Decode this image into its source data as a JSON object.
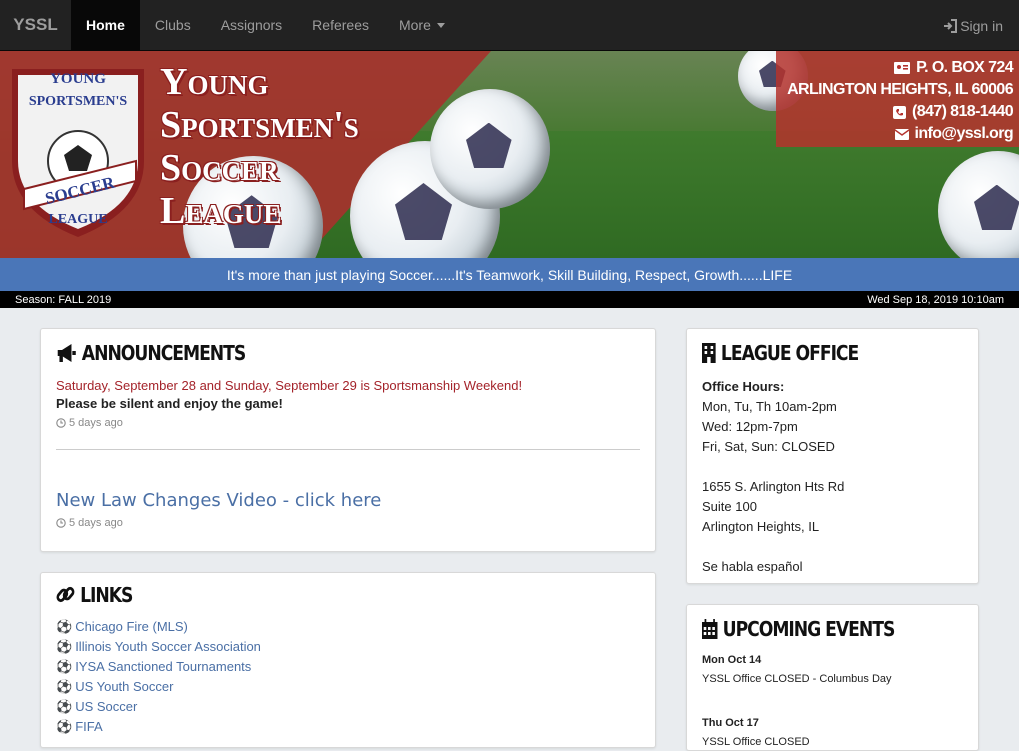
{
  "nav": {
    "brand": "YSSL",
    "items": [
      {
        "label": "Home",
        "active": true
      },
      {
        "label": "Clubs"
      },
      {
        "label": "Assignors"
      },
      {
        "label": "Referees"
      },
      {
        "label": "More"
      }
    ],
    "signin": "Sign in"
  },
  "banner": {
    "logo_text": {
      "top": "YOUNG",
      "mid": "SPORTSMEN'S",
      "band": "SOCCER",
      "bottom": "LEAGUE"
    },
    "title_lines": [
      "Young",
      "Sportsmen's",
      "Soccer",
      "League"
    ],
    "contact": {
      "address1": "P. O. BOX 724",
      "address2": "ARLINGTON HEIGHTS, IL 60006",
      "phone": "(847) 818-1440",
      "email": "info@yssl.org"
    }
  },
  "tagline": "It's more than just playing Soccer......It's Teamwork, Skill Building, Respect, Growth......LIFE",
  "status": {
    "season": "Season: FALL 2019",
    "datetime": "Wed Sep 18, 2019 10:10am"
  },
  "announcements": {
    "title": "ANNOUNCEMENTS",
    "items": [
      {
        "headline": "Saturday, September 28 and Sunday, September 29 is Sportsmanship Weekend!",
        "body": "Please be silent and enjoy the game!",
        "time": "5 days ago"
      },
      {
        "link": "New Law Changes Video - click here",
        "time": "5 days ago"
      }
    ]
  },
  "links": {
    "title": "LINKS",
    "items": [
      "Chicago Fire (MLS)",
      "Illinois Youth Soccer Association",
      "IYSA Sanctioned Tournaments",
      "US Youth Soccer",
      "US Soccer",
      "FIFA"
    ]
  },
  "office": {
    "title": "LEAGUE OFFICE",
    "hours_label": "Office Hours:",
    "hours": [
      "Mon, Tu, Th 10am-2pm",
      "Wed: 12pm-7pm",
      "Fri, Sat, Sun: CLOSED"
    ],
    "address": [
      "1655 S. Arlington Hts Rd",
      "Suite 100",
      "Arlington Heights, IL"
    ],
    "note": "Se habla español"
  },
  "events": {
    "title": "UPCOMING EVENTS",
    "items": [
      {
        "date": "Mon Oct 14",
        "desc": "YSSL Office CLOSED - Columbus Day"
      },
      {
        "date": "Thu Oct 17",
        "desc": "YSSL Office CLOSED"
      }
    ]
  },
  "colors": {
    "navbar": "#222222",
    "tagline": "#4a76b8",
    "alert": "#a4232a",
    "link": "#4a6fa5",
    "banner_red": "#a5322c"
  }
}
